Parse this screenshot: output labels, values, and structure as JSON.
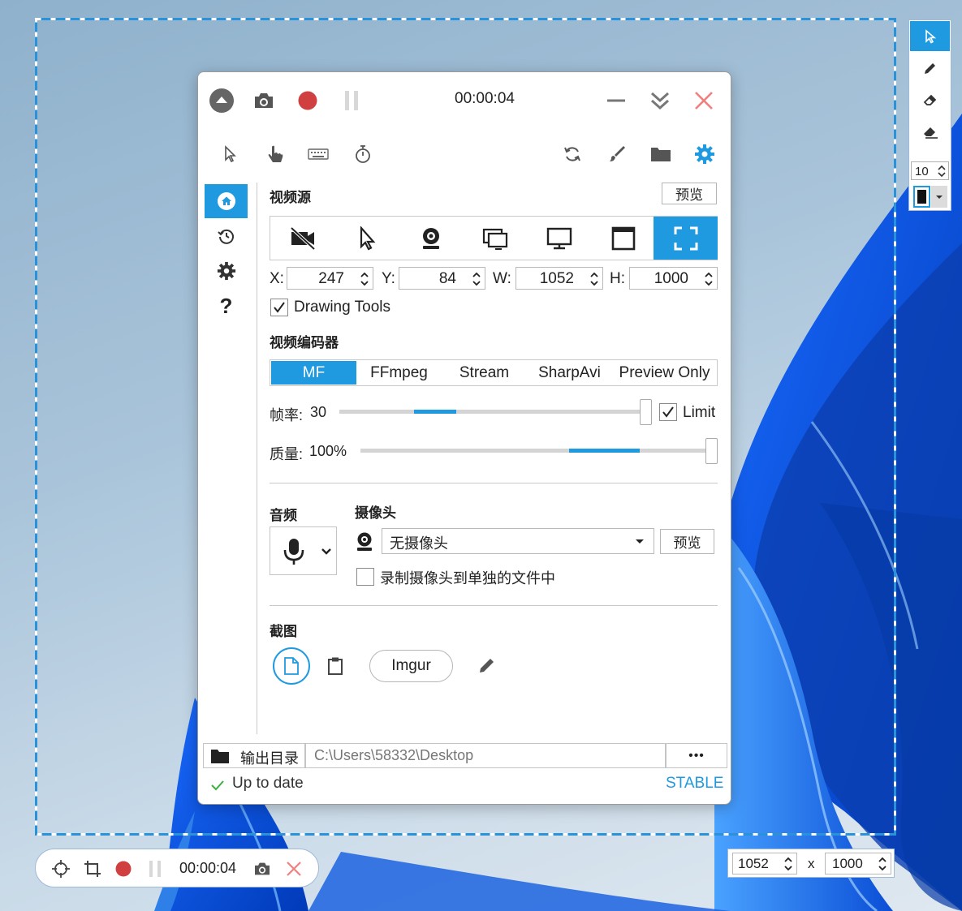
{
  "window": {
    "timer": "00:00:04"
  },
  "video_source": {
    "title": "视频源",
    "preview_label": "预览",
    "x_label": "X:",
    "x_value": "247",
    "y_label": "Y:",
    "y_value": "84",
    "w_label": "W:",
    "w_value": "1052",
    "h_label": "H:",
    "h_value": "1000",
    "drawing_tools_label": "Drawing Tools",
    "drawing_tools_checked": true
  },
  "encoder": {
    "title": "视频编码器",
    "tabs": [
      "MF",
      "FFmpeg",
      "Stream",
      "SharpAvi",
      "Preview Only"
    ],
    "selected_tab": "MF",
    "fps_label": "帧率:",
    "fps_value": "30",
    "limit_label": "Limit",
    "limit_checked": true,
    "quality_label": "质量:",
    "quality_value": "100%"
  },
  "audio": {
    "title": "音频"
  },
  "webcam": {
    "title": "摄像头",
    "selected": "无摄像头",
    "preview_label": "预览",
    "separate_file_label": "录制摄像头到单独的文件中",
    "separate_file_checked": false
  },
  "screenshot": {
    "title": "截图",
    "imgur_label": "Imgur"
  },
  "output": {
    "label": "输出目录",
    "path": "C:\\Users\\58332\\Desktop",
    "more_label": "•••"
  },
  "status": {
    "text": "Up to date",
    "channel": "STABLE"
  },
  "mini_bar": {
    "timer": "00:00:04"
  },
  "size_box": {
    "width": "1052",
    "sep": "x",
    "height": "1000"
  },
  "drawing_panel": {
    "brush_size": "10"
  },
  "colors": {
    "accent": "#1f9ae0",
    "record_red": "#d04040",
    "close_red": "#f08080"
  }
}
